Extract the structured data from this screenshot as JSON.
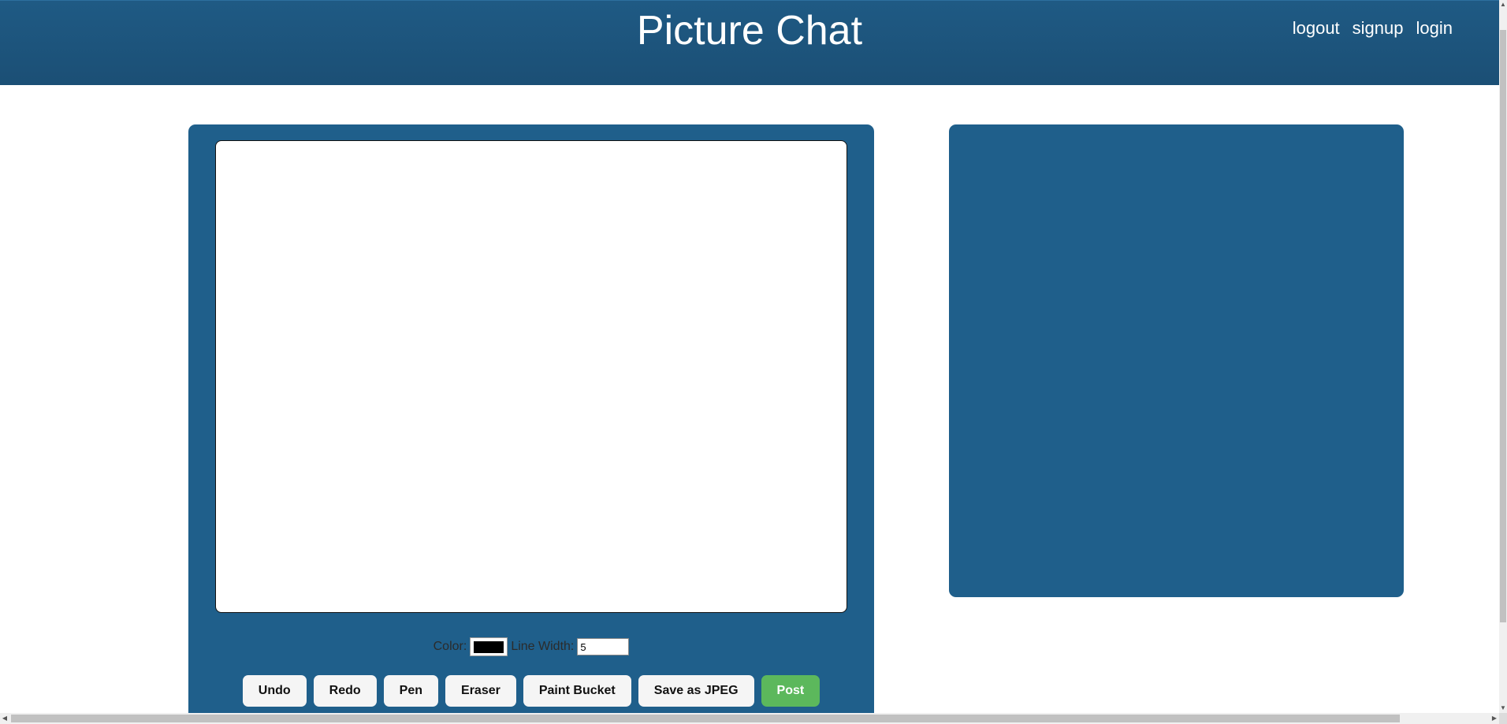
{
  "header": {
    "title": "Picture Chat",
    "nav": {
      "logout": "logout",
      "signup": "signup",
      "login": "login"
    }
  },
  "drawing": {
    "color_label": "Color:",
    "color_value": "#000000",
    "line_width_label": "Line Width:",
    "line_width_value": "5",
    "buttons": {
      "undo": "Undo",
      "redo": "Redo",
      "pen": "Pen",
      "eraser": "Eraser",
      "paint_bucket": "Paint Bucket",
      "save_jpeg": "Save as JPEG",
      "post": "Post"
    }
  },
  "colors": {
    "header_bg": "#1c5279",
    "panel_bg": "#1f5f8b",
    "post_button": "#5cb85c"
  }
}
